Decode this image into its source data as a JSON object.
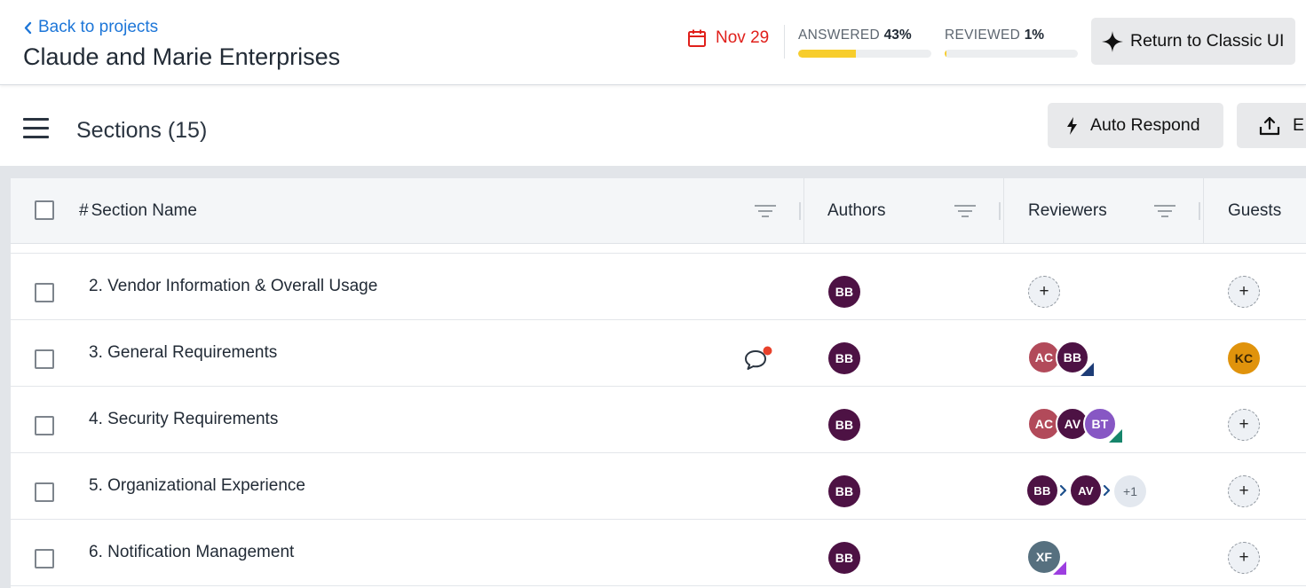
{
  "header": {
    "back_label": "Back to projects",
    "project_title": "Claude and Marie Enterprises",
    "due_date": "Nov 29",
    "answered": {
      "label": "ANSWERED",
      "percent_text": "43%",
      "value": 43
    },
    "reviewed": {
      "label": "REVIEWED",
      "percent_text": "1%",
      "value": 1
    },
    "classic_button": "Return to Classic UI"
  },
  "toolbar": {
    "sections_title": "Sections (15)",
    "auto_respond": "Auto Respond",
    "export_partial": "E"
  },
  "table": {
    "columns": {
      "hash": "#",
      "section_name": "Section Name",
      "authors": "Authors",
      "reviewers": "Reviewers",
      "guests": "Guests"
    },
    "rows": [
      {
        "name": "2. Vendor Information & Overall Usage",
        "author": "BB",
        "reviewers": [],
        "guest": null
      },
      {
        "name": "3. General Requirements",
        "has_comment": true,
        "author": "BB",
        "reviewers": [
          "AC",
          "BB"
        ],
        "guest": "KC"
      },
      {
        "name": "4. Security Requirements",
        "author": "BB",
        "reviewers": [
          "AC",
          "AV",
          "BT"
        ],
        "guest": null
      },
      {
        "name": "5. Organizational Experience",
        "author": "BB",
        "reviewers": [
          "BB",
          "AV"
        ],
        "reviewers_more": "+1",
        "guest": null
      },
      {
        "name": "6. Notification Management",
        "author": "BB",
        "reviewers": [
          "XF"
        ],
        "guest": null
      }
    ]
  },
  "colors": {
    "accent_link": "#1d76d8",
    "due_red": "#e0201b",
    "progress_yellow": "#f7cd2c",
    "avatar_bb": "#4d1244",
    "avatar_ac": "#b24a5a",
    "avatar_av": "#4d1244",
    "avatar_bt": "#8757c4",
    "avatar_xf": "#56707f",
    "avatar_kc": "#e0930c",
    "corner_navy": "#1d3c76",
    "corner_green": "#16856b",
    "corner_purple": "#9d3ee0",
    "comment_badge": "#e8412b"
  },
  "icons": {
    "back": "chevron-left-icon",
    "calendar": "calendar-icon",
    "sparkle": "sparkle-icon",
    "menu": "hamburger-menu-icon",
    "bolt": "lightning-bolt-icon",
    "export": "upload-icon",
    "filter": "filter-icon",
    "comment": "comment-icon",
    "add": "plus-icon",
    "sequence": "chevron-right-icon"
  }
}
